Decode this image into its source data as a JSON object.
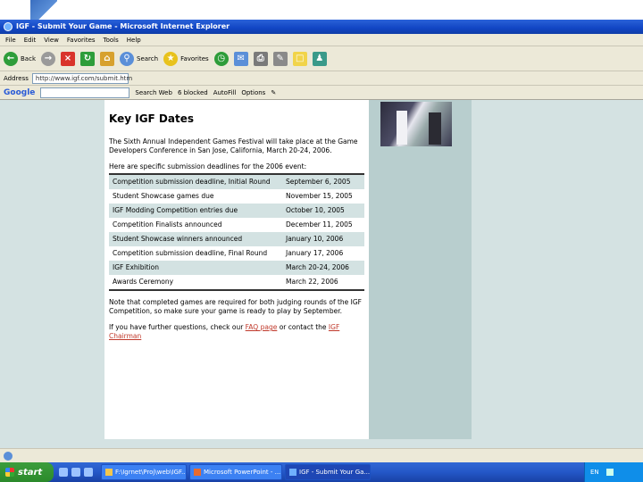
{
  "window": {
    "title": "IGF - Submit Your Game - Microsoft Internet Explorer"
  },
  "menu": [
    "File",
    "Edit",
    "View",
    "Favorites",
    "Tools",
    "Help"
  ],
  "toolbar": {
    "back": "Back",
    "search": "Search",
    "favorites": "Favorites"
  },
  "address": {
    "label": "Address",
    "value": "http://www.igf.com/submit.htm"
  },
  "google": {
    "logo": "Google",
    "search_web": "Search Web",
    "blocked": "6 blocked",
    "autofill": "AutoFill",
    "options": "Options"
  },
  "page": {
    "title": "Key IGF Dates",
    "intro": "The Sixth Annual Independent Games Festival will take place at the Game Developers Conference in San Jose, California, March 20-24, 2006.",
    "deadlines_intro": "Here are specific submission deadlines for the 2006 event:",
    "dates": [
      {
        "event": "Competition submission deadline, Initial Round",
        "date": "September 6, 2005"
      },
      {
        "event": "Student Showcase games due",
        "date": "November 15, 2005"
      },
      {
        "event": "IGF Modding Competition entries due",
        "date": "October 10, 2005"
      },
      {
        "event": "Competition Finalists announced",
        "date": "December 11, 2005"
      },
      {
        "event": "Student Showcase winners announced",
        "date": "January 10, 2006"
      },
      {
        "event": "Competition submission deadline, Final Round",
        "date": "January 17, 2006"
      },
      {
        "event": "IGF Exhibition",
        "date": "March 20-24, 2006"
      },
      {
        "event": "Awards Ceremony",
        "date": "March 22, 2006"
      }
    ],
    "note": "Note that completed games are required for both judging rounds of the IGF Competition, so make sure your game is ready to play by September.",
    "questions_prefix": "If you have further questions, check our ",
    "faq_link": "FAQ page",
    "questions_middle": " or contact the ",
    "chairman_link": "IGF Chairman"
  },
  "taskbar": {
    "start": "start",
    "tasks": [
      "F:\\Igrnet\\Proj\\web\\IGF...",
      "Microsoft PowerPoint - ...",
      "IGF - Submit Your Ga..."
    ],
    "tray_lang": "EN"
  },
  "colors": {
    "accent": "#1145c4",
    "row_alt": "#d3e2e2",
    "page_bg": "#d4e2e2"
  }
}
